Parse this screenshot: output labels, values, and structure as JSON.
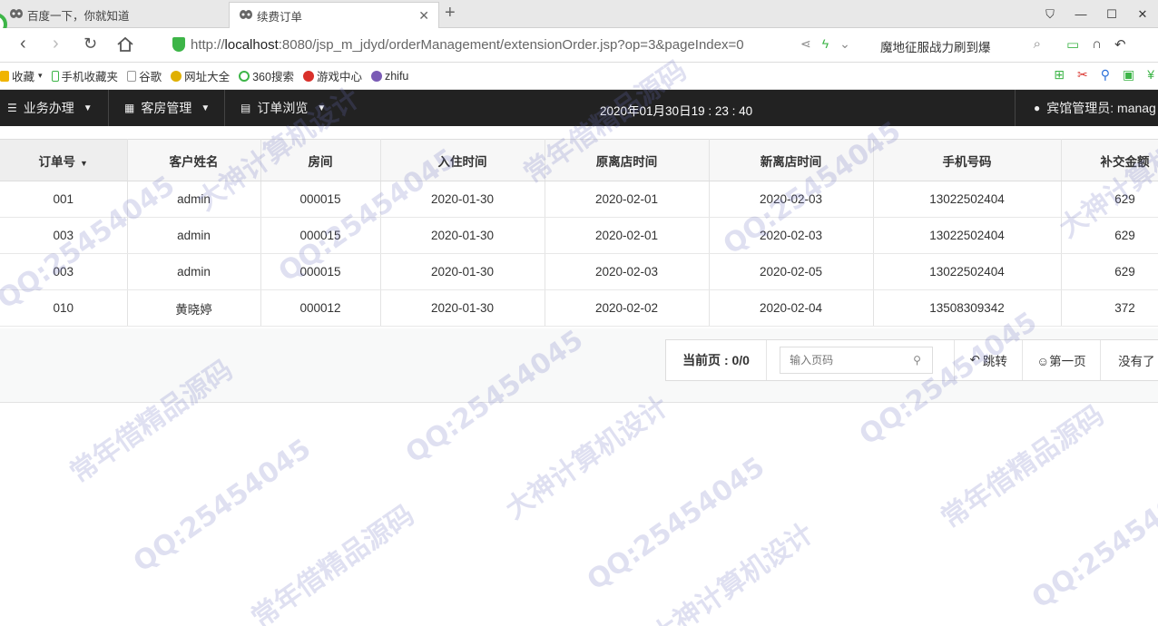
{
  "browser": {
    "tabs": [
      {
        "label": "百度一下，你就知道",
        "active": false
      },
      {
        "label": "续费订单",
        "active": true
      }
    ],
    "address": {
      "url_prefix": "http://",
      "url_host": "localhost",
      "url_rest": ":8080/jsp_m_jdyd/orderManagement/extensionOrder.jsp?op=3&pageIndex=0"
    },
    "search_text": "魔地征服战力刷到爆",
    "bookmarks": [
      "收藏",
      "手机收藏夹",
      "谷歌",
      "网址大全",
      "360搜索",
      "游戏中心",
      "zhifu"
    ]
  },
  "appnav": {
    "menus": [
      "业务办理",
      "客房管理",
      "订单浏览"
    ],
    "clock": "2020年01月30日19 : 23 : 40",
    "admin": "宾馆管理员: manag"
  },
  "table": {
    "headers": [
      "订单号",
      "客户姓名",
      "房间",
      "入住时间",
      "原离店时间",
      "新离店时间",
      "手机号码",
      "补交金额"
    ],
    "rows": [
      [
        "001",
        "admin",
        "000015",
        "2020-01-30",
        "2020-02-01",
        "2020-02-03",
        "13022502404",
        "629"
      ],
      [
        "003",
        "admin",
        "000015",
        "2020-01-30",
        "2020-02-01",
        "2020-02-03",
        "13022502404",
        "629"
      ],
      [
        "003",
        "admin",
        "000015",
        "2020-01-30",
        "2020-02-03",
        "2020-02-05",
        "13022502404",
        "629"
      ],
      [
        "010",
        "黄晓婷",
        "000012",
        "2020-01-30",
        "2020-02-02",
        "2020-02-04",
        "13508309342",
        "372"
      ]
    ]
  },
  "pagination": {
    "current_label": "当前页 : 0/0",
    "input_placeholder": "输入页码",
    "jump_label": "跳转",
    "first_label": "☺第一页",
    "none_label": "没有了"
  },
  "watermark": [
    "QQ:25454045",
    "常年借精品源码",
    "大神计算机设计"
  ]
}
